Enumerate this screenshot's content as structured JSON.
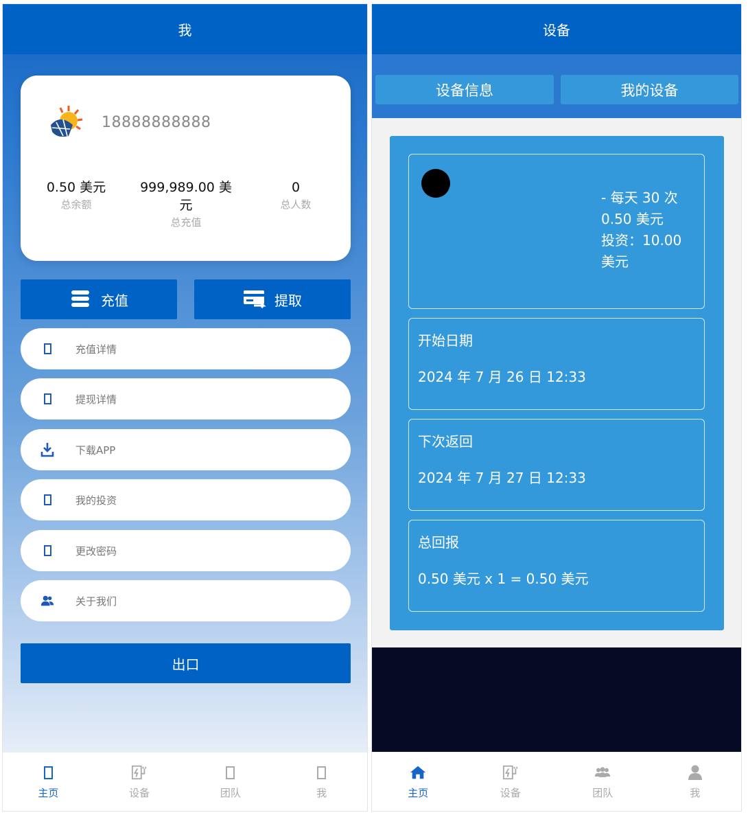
{
  "left": {
    "title": "我",
    "profile": {
      "phone": "18888888888",
      "stats": [
        {
          "value": "0.50 美元",
          "label": "总余额"
        },
        {
          "value": "999,989.00 美元",
          "label": "总充值"
        },
        {
          "value": "0",
          "label": "总人数"
        }
      ]
    },
    "actions": {
      "recharge": "充值",
      "withdraw": "提取"
    },
    "menu": [
      {
        "label": "充值详情",
        "icon": "box-icon"
      },
      {
        "label": "提现详情",
        "icon": "box-icon"
      },
      {
        "label": "下载APP",
        "icon": "download-icon"
      },
      {
        "label": "我的投资",
        "icon": "box-icon"
      },
      {
        "label": "更改密码",
        "icon": "box-icon"
      },
      {
        "label": "关于我们",
        "icon": "users-icon"
      }
    ],
    "logout": "出口",
    "tabbar": [
      {
        "label": "主页"
      },
      {
        "label": "设备"
      },
      {
        "label": "团队"
      },
      {
        "label": "我"
      }
    ]
  },
  "right": {
    "title": "设备",
    "tabs": [
      "设备信息",
      "我的设备"
    ],
    "device": {
      "plan_line1": "- 每天 30 次",
      "plan_line2": "0.50 美元",
      "plan_line3": "投资：10.00 美元"
    },
    "start": {
      "title": "开始日期",
      "value": "2024 年 7 月 26 日 12:33"
    },
    "next": {
      "title": "下次返回",
      "value": "2024 年 7 月 27 日 12:33"
    },
    "total": {
      "title": "总回报",
      "value": "0.50 美元 x 1 = 0.50 美元"
    },
    "tabbar": [
      {
        "label": "主页"
      },
      {
        "label": "设备"
      },
      {
        "label": "团队"
      },
      {
        "label": "我"
      }
    ]
  },
  "colors": {
    "primary": "#0062c4",
    "panel": "#3399db",
    "active_tab": "#1566c6"
  }
}
